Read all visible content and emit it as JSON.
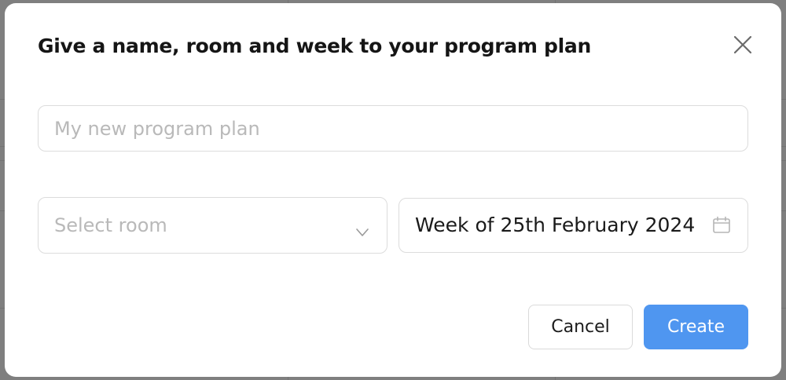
{
  "dialog": {
    "title": "Give a name, room and week to your program plan",
    "close_icon": "close-x-icon"
  },
  "form": {
    "name_input": {
      "placeholder": "My new program plan",
      "value": ""
    },
    "room_select": {
      "placeholder": "Select room",
      "icon": "chevron-down-icon"
    },
    "week_picker": {
      "value": "Week of 25th February 2024",
      "icon": "calendar-icon"
    }
  },
  "actions": {
    "cancel_label": "Cancel",
    "create_label": "Create"
  },
  "colors": {
    "primary": "#4f96f0",
    "backdrop": "#7f7f7f",
    "border": "#dcdcdc",
    "placeholder": "#b9b9b9"
  }
}
